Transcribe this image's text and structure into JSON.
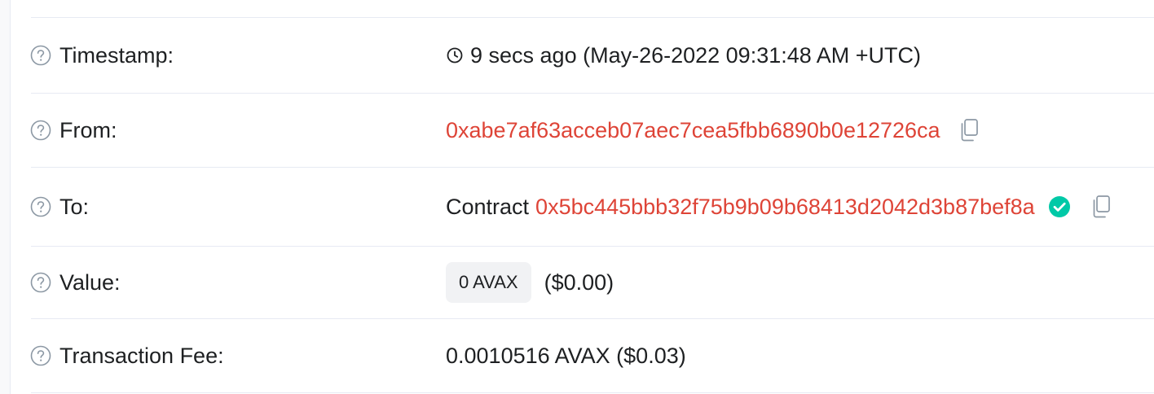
{
  "rows": {
    "timestamp": {
      "label": "Timestamp:",
      "value": "9 secs ago (May-26-2022 09:31:48 AM +UTC)"
    },
    "from": {
      "label": "From:",
      "address": "0xabe7af63acceb07aec7cea5fbb6890b0e12726ca"
    },
    "to": {
      "label": "To:",
      "prefix": "Contract",
      "address": "0x5bc445bbb32f75b9b09b68413d2042d3b87bef8a"
    },
    "value": {
      "label": "Value:",
      "amount": "0 AVAX",
      "usd": "($0.00)"
    },
    "fee": {
      "label": "Transaction Fee:",
      "value": "0.0010516 AVAX ($0.03)"
    }
  },
  "icons": {
    "help": "question-circle-icon",
    "clock": "clock-icon",
    "copy": "copy-icon",
    "verified": "check-circle-icon"
  },
  "colors": {
    "address_link": "#de4437",
    "verified": "#00c9a7",
    "badge_bg": "#f1f2f4",
    "divider": "#e7eaf3"
  }
}
